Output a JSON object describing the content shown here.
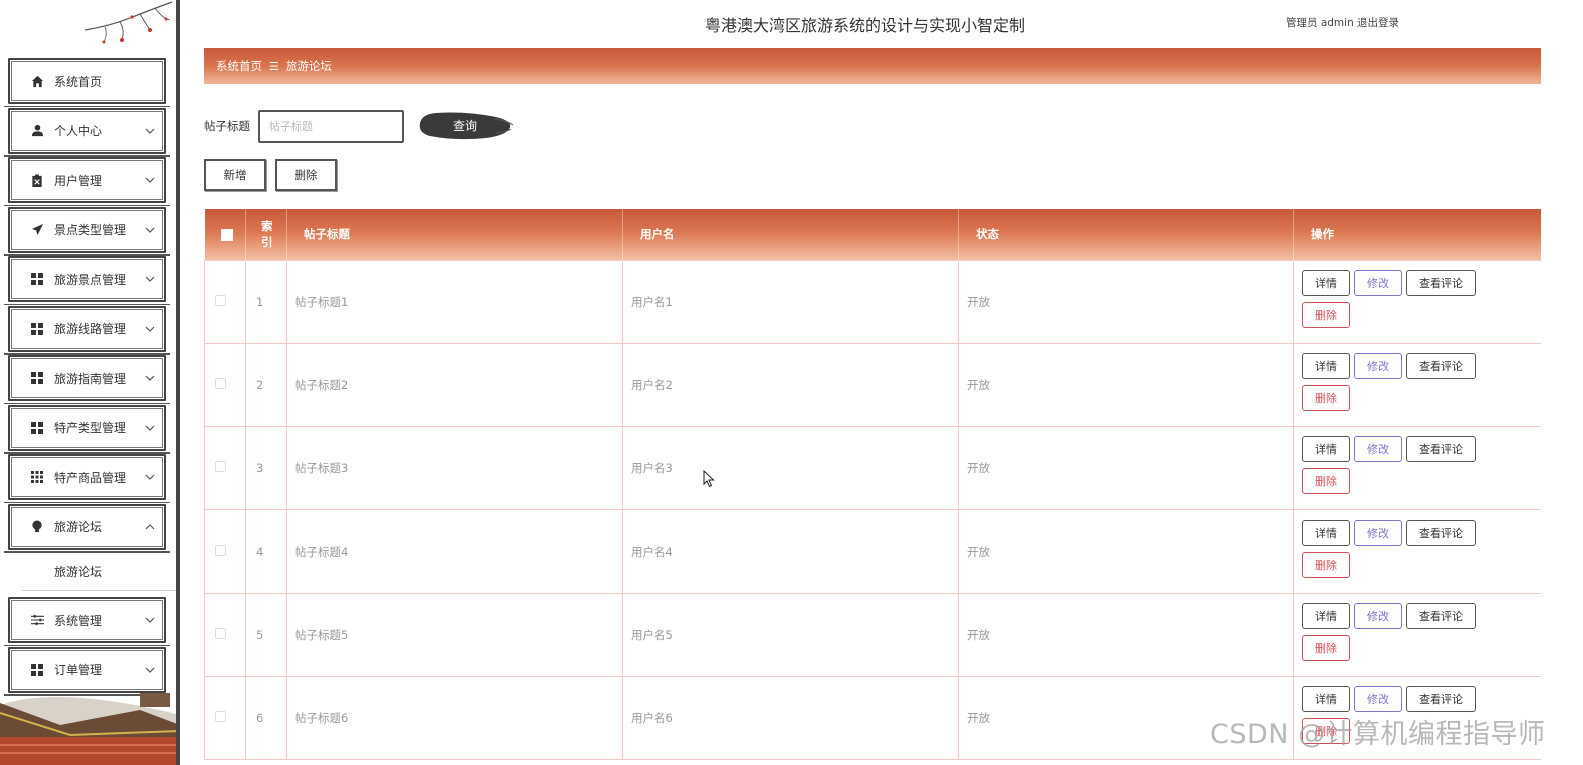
{
  "header": {
    "title": "粤港澳大湾区旅游系统的设计与实现小智定制",
    "user": "管理员 admin",
    "logout": "退出登录"
  },
  "sidebar": {
    "items": [
      {
        "label": "系统首页",
        "icon": "home-icon"
      },
      {
        "label": "个人中心",
        "icon": "user-icon"
      },
      {
        "label": "用户管理",
        "icon": "clipboard-icon"
      },
      {
        "label": "景点类型管理",
        "icon": "paper-plane-icon"
      },
      {
        "label": "旅游景点管理",
        "icon": "grid-icon"
      },
      {
        "label": "旅游线路管理",
        "icon": "grid-icon"
      },
      {
        "label": "旅游指南管理",
        "icon": "grid-icon"
      },
      {
        "label": "特产类型管理",
        "icon": "grid-icon"
      },
      {
        "label": "特产商品管理",
        "icon": "grid-9-icon"
      },
      {
        "label": "旅游论坛",
        "icon": "bulb-icon"
      },
      {
        "label": "系统管理",
        "icon": "sliders-icon"
      },
      {
        "label": "订单管理",
        "icon": "grid-icon"
      }
    ],
    "submenu": "旅游论坛"
  },
  "breadcrumb": {
    "home": "系统首页",
    "sep": "☰",
    "current": "旅游论坛"
  },
  "search": {
    "label": "帖子标题",
    "placeholder": "帖子标题",
    "value": "",
    "button": "查询"
  },
  "actions": {
    "add": "新增",
    "delete": "删除"
  },
  "table": {
    "columns": [
      "索引",
      "帖子标题",
      "用户名",
      "状态",
      "操作"
    ],
    "index_header": "索\n引",
    "rows": [
      {
        "index": "1",
        "title": "帖子标题1",
        "user": "用户名1",
        "status": "开放"
      },
      {
        "index": "2",
        "title": "帖子标题2",
        "user": "用户名2",
        "status": "开放"
      },
      {
        "index": "3",
        "title": "帖子标题3",
        "user": "用户名3",
        "status": "开放"
      },
      {
        "index": "4",
        "title": "帖子标题4",
        "user": "用户名4",
        "status": "开放"
      },
      {
        "index": "5",
        "title": "帖子标题5",
        "user": "用户名5",
        "status": "开放"
      },
      {
        "index": "6",
        "title": "帖子标题6",
        "user": "用户名6",
        "status": "开放"
      }
    ],
    "row_actions": {
      "detail": "详情",
      "edit": "修改",
      "comments": "查看评论",
      "delete": "删除"
    }
  },
  "watermark": "CSDN @计算机编程指导师",
  "colors": {
    "accent": "#c8583a",
    "accent_light": "#f1b89a",
    "edit": "#7a77c5",
    "danger": "#d0505a"
  }
}
